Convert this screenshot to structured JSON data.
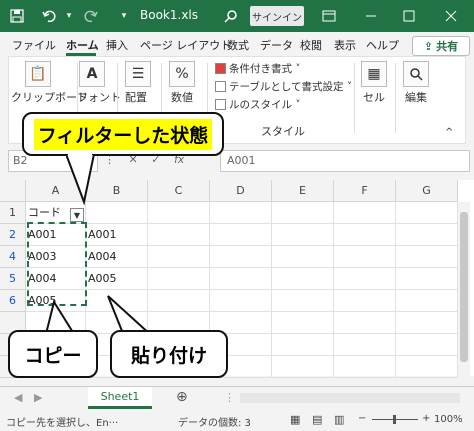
{
  "titlebar": {
    "title": "Book1.xls",
    "signin": "サインイン"
  },
  "tabs": [
    "ファイル",
    "ホーム",
    "挿入",
    "ページ レイアウト",
    "数式",
    "データ",
    "校閲",
    "表示",
    "ヘルプ"
  ],
  "share": "共有",
  "ribbon": {
    "clipboard": "クリップボード",
    "font": "フォント",
    "alignment": "配置",
    "number": "数値",
    "conditional_format": "条件付き書式 ˅",
    "table_format": "テーブルとして書式設定 ˅",
    "cell_style": "ルのスタイル ˅",
    "styles_group": "スタイル",
    "cells": "セル",
    "editing": "編集"
  },
  "formula_bar": {
    "name_box": "B2",
    "fx_label": "fx",
    "value": "A001"
  },
  "columns": [
    "A",
    "B",
    "C",
    "D",
    "E",
    "F",
    "G"
  ],
  "rows": [
    {
      "num": "1",
      "cells": [
        "コード",
        "",
        "",
        "",
        "",
        "",
        ""
      ],
      "filtered": false
    },
    {
      "num": "2",
      "cells": [
        "A001",
        "A001",
        "",
        "",
        "",
        "",
        ""
      ],
      "filtered": true
    },
    {
      "num": "4",
      "cells": [
        "A003",
        "A004",
        "",
        "",
        "",
        "",
        ""
      ],
      "filtered": true
    },
    {
      "num": "5",
      "cells": [
        "A004",
        "A005",
        "",
        "",
        "",
        "",
        ""
      ],
      "filtered": true
    },
    {
      "num": "6",
      "cells": [
        "A005",
        "",
        "",
        "",
        "",
        "",
        ""
      ],
      "filtered": true
    },
    {
      "num": "",
      "cells": [
        "",
        "",
        "",
        "",
        "",
        "",
        ""
      ],
      "filtered": false
    },
    {
      "num": "",
      "cells": [
        "",
        "",
        "",
        "",
        "",
        "",
        ""
      ],
      "filtered": false
    },
    {
      "num": "",
      "cells": [
        "",
        "",
        "",
        "",
        "",
        "",
        ""
      ],
      "filtered": false
    }
  ],
  "sheet_tab": "Sheet1",
  "status": {
    "left": "コピー先を選択し、En···",
    "count": "データの個数: 3",
    "zoom": "100%"
  },
  "callouts": {
    "filtered": "フィルターした状態",
    "copy": "コピー",
    "paste": "貼り付け"
  },
  "colors": {
    "excel_green": "#217346",
    "highlight": "#ffff00",
    "row_number_blue": "#1a4fd0"
  }
}
